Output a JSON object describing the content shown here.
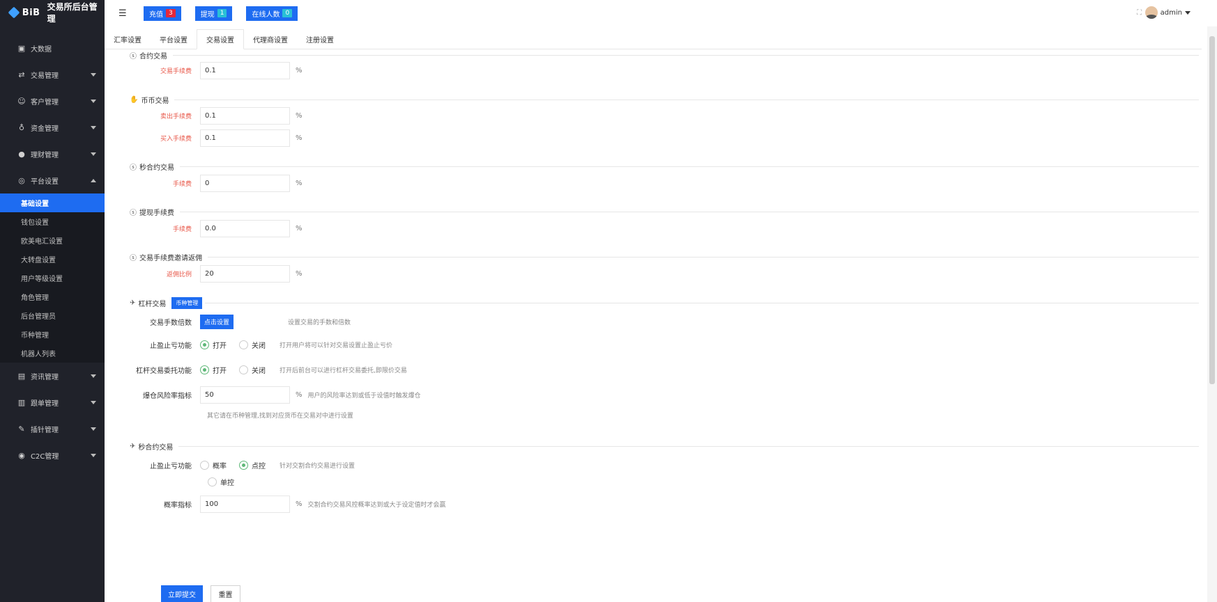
{
  "logo": {
    "brand": "BiB",
    "title": "交易所后台管理"
  },
  "sidebar": {
    "groups": [
      {
        "label": "大数据",
        "icon": "monitor-icon"
      },
      {
        "label": "交易管理",
        "icon": "exchange-icon"
      },
      {
        "label": "客户管理",
        "icon": "users-icon"
      },
      {
        "label": "资金管理",
        "icon": "money-bag-icon"
      },
      {
        "label": "理财管理",
        "icon": "piggy-bank-icon"
      },
      {
        "label": "平台设置",
        "icon": "settings-icon"
      },
      {
        "label": "资讯管理",
        "icon": "news-icon"
      },
      {
        "label": "跟单管理",
        "icon": "document-icon"
      },
      {
        "label": "插针管理",
        "icon": "pin-icon"
      },
      {
        "label": "C2C管理",
        "icon": "c2c-icon"
      }
    ],
    "sub_items": [
      "基础设置",
      "钱包设置",
      "欧美电汇设置",
      "大转盘设置",
      "用户等级设置",
      "角色管理",
      "后台管理员",
      "币种管理",
      "机器人列表"
    ]
  },
  "header": {
    "recharge": {
      "label": "充值",
      "count": "3"
    },
    "withdraw": {
      "label": "提现",
      "count": "1"
    },
    "online": {
      "label": "在线人数",
      "count": "0"
    },
    "username": "admin"
  },
  "tabs": [
    "汇率设置",
    "平台设置",
    "交易设置",
    "代理商设置",
    "注册设置"
  ],
  "form": {
    "contract": {
      "title": "合约交易",
      "fee_label": "交易手续费",
      "fee_value": "0.1",
      "unit": "%"
    },
    "spot": {
      "title": "币币交易",
      "sell_label": "卖出手续费",
      "sell_value": "0.1",
      "buy_label": "买入手续费",
      "buy_value": "0.1",
      "unit": "%"
    },
    "second_contract": {
      "title": "秒合约交易",
      "fee_label": "手续费",
      "fee_value": "0",
      "unit": "%"
    },
    "withdraw_fee": {
      "title": "提现手续费",
      "fee_label": "手续费",
      "fee_value": "0.0",
      "unit": "%"
    },
    "rebate": {
      "title": "交易手续费邀请返佣",
      "ratio_label": "返佣比例",
      "ratio_value": "20",
      "unit": "%"
    },
    "leverage": {
      "title": "杠杆交易",
      "coin_manage_button": "币种管理",
      "hands_label": "交易手数倍数",
      "hands_button": "点击设置",
      "hands_hint": "设置交易的手数和倍数",
      "stop_label": "止盈止亏功能",
      "stop_on": "打开",
      "stop_off": "关闭",
      "stop_hint": "打开用户将可以针对交易设置止盈止亏价",
      "entrust_label": "杠杆交易委托功能",
      "entrust_on": "打开",
      "entrust_off": "关闭",
      "entrust_hint": "打开后前台可以进行杠杆交易委托,即限价交易",
      "risk_label": "爆仓风险率指标",
      "risk_value": "50",
      "risk_unit": "%",
      "risk_hint": "用户的风险率达到或低于设值时触发爆仓",
      "note": "其它请在币种管理,找到对应货币在交易对中进行设置"
    },
    "second_contract2": {
      "title": "秒合约交易",
      "stop_label": "止盈止亏功能",
      "opt_probability": "概率",
      "opt_point": "点控",
      "opt_single": "单控",
      "stop_hint": "针对交割合约交易进行设置",
      "prob_label": "概率指标",
      "prob_value": "100",
      "prob_unit": "%",
      "prob_hint": "交割合约交易风控概率达到或大于设定值时才会赢"
    },
    "submit": "立即提交",
    "reset": "重置"
  }
}
